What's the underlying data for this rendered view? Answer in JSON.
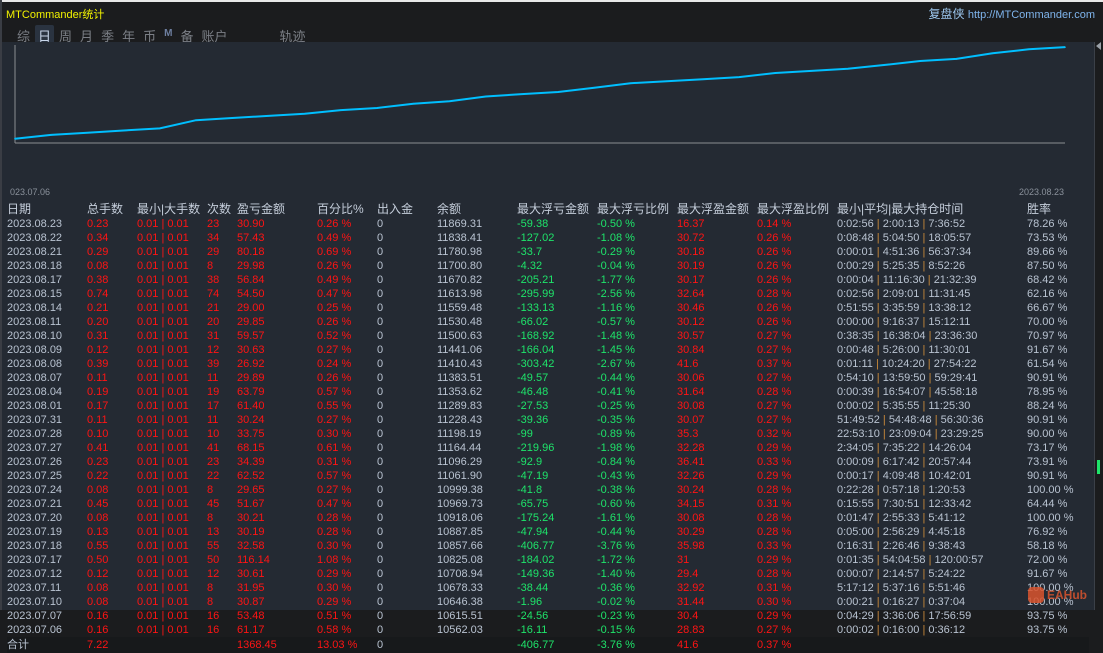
{
  "app": {
    "title": "MTCommander统计",
    "brand": "复盘侠",
    "url": "http://MTCommander.com",
    "watermark": "EAHub"
  },
  "tabs": [
    {
      "label": "综"
    },
    {
      "label": "日",
      "active": true
    },
    {
      "label": "周"
    },
    {
      "label": "月"
    },
    {
      "label": "季"
    },
    {
      "label": "年"
    },
    {
      "label": "币"
    },
    {
      "label": "M"
    },
    {
      "label": "备"
    },
    {
      "label": "账户"
    },
    {
      "label": "轨迹"
    }
  ],
  "colors": {
    "line": "#00bfff",
    "profit": "#ff1414",
    "loss": "#1ee46a",
    "text": "#c5cedb",
    "background": "#242a33"
  },
  "chart_data": {
    "type": "line",
    "x_start_label": "023.07.06",
    "x_end_label": "2023.08.23",
    "x": [
      "2023.07.06",
      "2023.07.07",
      "2023.07.10",
      "2023.07.11",
      "2023.07.12",
      "2023.07.17",
      "2023.07.18",
      "2023.07.19",
      "2023.07.20",
      "2023.07.21",
      "2023.07.24",
      "2023.07.25",
      "2023.07.26",
      "2023.07.27",
      "2023.07.28",
      "2023.07.31",
      "2023.08.01",
      "2023.08.04",
      "2023.08.07",
      "2023.08.08",
      "2023.08.09",
      "2023.08.10",
      "2023.08.11",
      "2023.08.14",
      "2023.08.15",
      "2023.08.17",
      "2023.08.18",
      "2023.08.21",
      "2023.08.22",
      "2023.08.23"
    ],
    "values": [
      10562.03,
      10615.51,
      10646.38,
      10678.33,
      10708.94,
      10825.08,
      10857.66,
      10887.85,
      10918.06,
      10969.73,
      10999.38,
      11061.9,
      11096.29,
      11164.44,
      11198.19,
      11228.43,
      11289.83,
      11353.62,
      11383.51,
      11410.43,
      11441.06,
      11500.63,
      11530.48,
      11559.48,
      11613.98,
      11670.82,
      11700.8,
      11780.98,
      11838.41,
      11869.31
    ],
    "ylim": [
      10500,
      11900
    ],
    "grid": false
  },
  "table": {
    "headers": [
      "日期",
      "总手数",
      "最小|大手数",
      "次数",
      "盈亏金额",
      "百分比%",
      "出入金",
      "余额",
      "最大浮亏金额",
      "最大浮亏比例",
      "最大浮盈金额",
      "最大浮盈比例",
      "最小|平均|最大持仓时间",
      "胜率"
    ],
    "rows": [
      [
        "2023.08.23",
        "0.23",
        "0.01 | 0.01",
        "23",
        "30.90",
        "0.26 %",
        "0",
        "11869.31",
        "-59.38",
        "-0.50 %",
        "16.37",
        "0.14 %",
        "0:02:56 | 2:00:13 | 7:36:52",
        "78.26 %"
      ],
      [
        "2023.08.22",
        "0.34",
        "0.01 | 0.01",
        "34",
        "57.43",
        "0.49 %",
        "0",
        "11838.41",
        "-127.02",
        "-1.08 %",
        "30.72",
        "0.26 %",
        "0:08:48 | 5:04:50 | 18:05:57",
        "73.53 %"
      ],
      [
        "2023.08.21",
        "0.29",
        "0.01 | 0.01",
        "29",
        "80.18",
        "0.69 %",
        "0",
        "11780.98",
        "-33.7",
        "-0.29 %",
        "30.18",
        "0.26 %",
        "0:00:01 | 4:51:36 | 56:37:34",
        "89.66 %"
      ],
      [
        "2023.08.18",
        "0.08",
        "0.01 | 0.01",
        "8",
        "29.98",
        "0.26 %",
        "0",
        "11700.80",
        "-4.32",
        "-0.04 %",
        "30.19",
        "0.26 %",
        "0:00:29 | 5:25:35 | 8:52:26",
        "87.50 %"
      ],
      [
        "2023.08.17",
        "0.38",
        "0.01 | 0.01",
        "38",
        "56.84",
        "0.49 %",
        "0",
        "11670.82",
        "-205.21",
        "-1.77 %",
        "30.17",
        "0.26 %",
        "0:00:04 | 11:16:30 | 21:32:39",
        "68.42 %"
      ],
      [
        "2023.08.15",
        "0.74",
        "0.01 | 0.01",
        "74",
        "54.50",
        "0.47 %",
        "0",
        "11613.98",
        "-295.99",
        "-2.56 %",
        "32.64",
        "0.28 %",
        "0:02:56 | 2:09:01 | 11:31:45",
        "62.16 %"
      ],
      [
        "2023.08.14",
        "0.21",
        "0.01 | 0.01",
        "21",
        "29.00",
        "0.25 %",
        "0",
        "11559.48",
        "-133.13",
        "-1.16 %",
        "30.46",
        "0.26 %",
        "0:51:55 | 3:35:59 | 13:38:12",
        "66.67 %"
      ],
      [
        "2023.08.11",
        "0.20",
        "0.01 | 0.01",
        "20",
        "29.85",
        "0.26 %",
        "0",
        "11530.48",
        "-66.02",
        "-0.57 %",
        "30.12",
        "0.26 %",
        "0:00:00 | 9:16:37 | 15:12:11",
        "70.00 %"
      ],
      [
        "2023.08.10",
        "0.31",
        "0.01 | 0.01",
        "31",
        "59.57",
        "0.52 %",
        "0",
        "11500.63",
        "-168.92",
        "-1.48 %",
        "30.57",
        "0.27 %",
        "0:38:35 | 16:38:04 | 23:36:30",
        "70.97 %"
      ],
      [
        "2023.08.09",
        "0.12",
        "0.01 | 0.01",
        "12",
        "30.63",
        "0.27 %",
        "0",
        "11441.06",
        "-166.04",
        "-1.45 %",
        "30.84",
        "0.27 %",
        "0:00:48 | 5:26:00 | 11:30:01",
        "91.67 %"
      ],
      [
        "2023.08.08",
        "0.39",
        "0.01 | 0.01",
        "39",
        "26.92",
        "0.24 %",
        "0",
        "11410.43",
        "-303.42",
        "-2.67 %",
        "41.6",
        "0.37 %",
        "0:01:11 | 10:24:20 | 27:54:22",
        "61.54 %"
      ],
      [
        "2023.08.07",
        "0.11",
        "0.01 | 0.01",
        "11",
        "29.89",
        "0.26 %",
        "0",
        "11383.51",
        "-49.57",
        "-0.44 %",
        "30.06",
        "0.27 %",
        "0:54:10 | 13:59:50 | 59:29:41",
        "90.91 %"
      ],
      [
        "2023.08.04",
        "0.19",
        "0.01 | 0.01",
        "19",
        "63.79",
        "0.57 %",
        "0",
        "11353.62",
        "-46.48",
        "-0.41 %",
        "31.64",
        "0.28 %",
        "0:00:39 | 16:54:07 | 45:58:18",
        "78.95 %"
      ],
      [
        "2023.08.01",
        "0.17",
        "0.01 | 0.01",
        "17",
        "61.40",
        "0.55 %",
        "0",
        "11289.83",
        "-27.53",
        "-0.25 %",
        "30.08",
        "0.27 %",
        "0:00:02 | 5:35:55 | 11:25:30",
        "88.24 %"
      ],
      [
        "2023.07.31",
        "0.11",
        "0.01 | 0.01",
        "11",
        "30.24",
        "0.27 %",
        "0",
        "11228.43",
        "-39.36",
        "-0.35 %",
        "30.07",
        "0.27 %",
        "51:49:52 | 54:48:48 | 56:30:36",
        "90.91 %"
      ],
      [
        "2023.07.28",
        "0.10",
        "0.01 | 0.01",
        "10",
        "33.75",
        "0.30 %",
        "0",
        "11198.19",
        "-99",
        "-0.89 %",
        "35.3",
        "0.32 %",
        "22:53:10 | 23:09:04 | 23:29:25",
        "90.00 %"
      ],
      [
        "2023.07.27",
        "0.41",
        "0.01 | 0.01",
        "41",
        "68.15",
        "0.61 %",
        "0",
        "11164.44",
        "-219.96",
        "-1.98 %",
        "32.28",
        "0.29 %",
        "2:34:05 | 7:35:22 | 14:26:04",
        "73.17 %"
      ],
      [
        "2023.07.26",
        "0.23",
        "0.01 | 0.01",
        "23",
        "34.39",
        "0.31 %",
        "0",
        "11096.29",
        "-92.9",
        "-0.84 %",
        "36.41",
        "0.33 %",
        "0:00:09 | 6:17:42 | 20:57:44",
        "73.91 %"
      ],
      [
        "2023.07.25",
        "0.22",
        "0.01 | 0.01",
        "22",
        "62.52",
        "0.57 %",
        "0",
        "11061.90",
        "-47.19",
        "-0.43 %",
        "32.26",
        "0.29 %",
        "0:00:17 | 4:09:48 | 10:42:01",
        "90.91 %"
      ],
      [
        "2023.07.24",
        "0.08",
        "0.01 | 0.01",
        "8",
        "29.65",
        "0.27 %",
        "0",
        "10999.38",
        "-41.8",
        "-0.38 %",
        "30.24",
        "0.28 %",
        "0:22:28 | 0:57:18 | 1:20:53",
        "100.00 %"
      ],
      [
        "2023.07.21",
        "0.45",
        "0.01 | 0.01",
        "45",
        "51.67",
        "0.47 %",
        "0",
        "10969.73",
        "-65.75",
        "-0.60 %",
        "34.15",
        "0.31 %",
        "0:15:55 | 7:30:51 | 12:33:42",
        "64.44 %"
      ],
      [
        "2023.07.20",
        "0.08",
        "0.01 | 0.01",
        "8",
        "30.21",
        "0.28 %",
        "0",
        "10918.06",
        "-175.24",
        "-1.61 %",
        "30.08",
        "0.28 %",
        "0:01:47 | 2:55:33 | 5:41:12",
        "100.00 %"
      ],
      [
        "2023.07.19",
        "0.13",
        "0.01 | 0.01",
        "13",
        "30.19",
        "0.28 %",
        "0",
        "10887.85",
        "-47.94",
        "-0.44 %",
        "30.29",
        "0.28 %",
        "0:05:00 | 2:56:29 | 4:45:18",
        "76.92 %"
      ],
      [
        "2023.07.18",
        "0.55",
        "0.01 | 0.01",
        "55",
        "32.58",
        "0.30 %",
        "0",
        "10857.66",
        "-406.77",
        "-3.76 %",
        "35.98",
        "0.33 %",
        "0:16:31 | 2:26:46 | 9:38:43",
        "58.18 %"
      ],
      [
        "2023.07.17",
        "0.50",
        "0.01 | 0.01",
        "50",
        "116.14",
        "1.08 %",
        "0",
        "10825.08",
        "-184.02",
        "-1.72 %",
        "31",
        "0.29 %",
        "0:01:35 | 54:04:58 | 120:00:57",
        "72.00 %"
      ],
      [
        "2023.07.12",
        "0.12",
        "0.01 | 0.01",
        "12",
        "30.61",
        "0.29 %",
        "0",
        "10708.94",
        "-149.36",
        "-1.40 %",
        "29.4",
        "0.28 %",
        "0:00:07 | 2:14:57 | 5:24:22",
        "91.67 %"
      ],
      [
        "2023.07.11",
        "0.08",
        "0.01 | 0.01",
        "8",
        "31.95",
        "0.30 %",
        "0",
        "10678.33",
        "-38.44",
        "-0.36 %",
        "32.92",
        "0.31 %",
        "5:17:12 | 5:37:16 | 5:51:46",
        "100.00 %"
      ],
      [
        "2023.07.10",
        "0.08",
        "0.01 | 0.01",
        "8",
        "30.87",
        "0.29 %",
        "0",
        "10646.38",
        "-1.96",
        "-0.02 %",
        "31.44",
        "0.30 %",
        "0:00:21 | 0:16:27 | 0:37:04",
        "100.00 %"
      ],
      [
        "2023.07.07",
        "0.16",
        "0.01 | 0.01",
        "16",
        "53.48",
        "0.51 %",
        "0",
        "10615.51",
        "-24.56",
        "-0.23 %",
        "30.4",
        "0.29 %",
        "0:04:29 | 3:36:06 | 17:56:59",
        "93.75 %"
      ],
      [
        "2023.07.06",
        "0.16",
        "0.01 | 0.01",
        "16",
        "61.17",
        "0.58 %",
        "0",
        "10562.03",
        "-16.11",
        "-0.15 %",
        "28.83",
        "0.27 %",
        "0:00:02 | 0:16:00 | 0:36:12",
        "93.75 %"
      ]
    ],
    "total": [
      "合计",
      "7.22",
      "",
      "",
      "1368.45",
      "13.03 %",
      "0",
      "",
      "-406.77",
      "-3.76 %",
      "41.6",
      "0.37 %",
      "",
      ""
    ]
  }
}
